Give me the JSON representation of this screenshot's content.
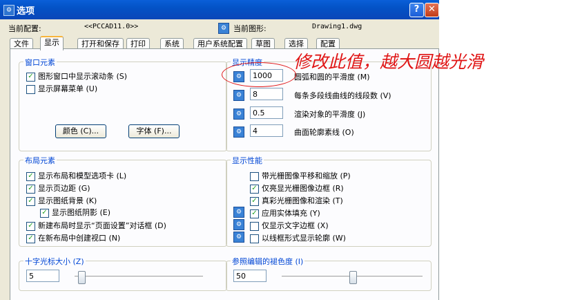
{
  "window": {
    "title": "选项",
    "help_glyph": "?",
    "close_glyph": "✕",
    "icon": "options-icon"
  },
  "info": {
    "profile_label": "当前配置:",
    "profile_value": "<<PCCAD11.0>>",
    "drawing_label": "当前图形:",
    "drawing_value": "Drawing1.dwg"
  },
  "tabs": [
    {
      "label": "文件"
    },
    {
      "label": "显示"
    },
    {
      "label": "打开和保存"
    },
    {
      "label": "打印"
    },
    {
      "label": "系统"
    },
    {
      "label": "用户系统配置"
    },
    {
      "label": "草图"
    },
    {
      "label": "选择"
    },
    {
      "label": "配置"
    }
  ],
  "active_tab": "显示",
  "window_elements": {
    "title": "窗口元素",
    "scrollbars": {
      "label": "图形窗口中显示滚动条 (S)",
      "checked": true
    },
    "screen_menu": {
      "label": "显示屏幕菜单 (U)",
      "checked": false
    },
    "colors_button": "颜色 (C)...",
    "fonts_button": "字体 (F)..."
  },
  "display_resolution": {
    "title": "显示精度",
    "arc_smoothness": {
      "value": "1000",
      "label": "圆弧和圆的平滑度 (M)"
    },
    "polyline_segments": {
      "value": "8",
      "label": "每条多段线曲线的线段数 (V)"
    },
    "render_smoothness": {
      "value": "0.5",
      "label": "渲染对象的平滑度 (J)"
    },
    "contour_lines": {
      "value": "4",
      "label": "曲面轮廓素线 (O)"
    }
  },
  "layout_elements": {
    "title": "布局元素",
    "items": [
      {
        "label": "显示布局和模型选项卡 (L)",
        "checked": true
      },
      {
        "label": "显示页边距 (G)",
        "checked": true
      },
      {
        "label": "显示图纸背景 (K)",
        "checked": true
      },
      {
        "label": "显示图纸阴影 (E)",
        "checked": true
      },
      {
        "label": "新建布局时显示“页面设置”对话框 (D)",
        "checked": true
      },
      {
        "label": "在新布局中创建视口 (N)",
        "checked": true
      }
    ]
  },
  "display_performance": {
    "title": "显示性能",
    "items": [
      {
        "label": "带光栅图像平移和缩放 (P)",
        "checked": false
      },
      {
        "label": "仅亮显光栅图像边框 (R)",
        "checked": true
      },
      {
        "label": "真彩光栅图像和渲染 (T)",
        "checked": true
      },
      {
        "label": "应用实体填充 (Y)",
        "checked": true
      },
      {
        "label": "仅显示文字边框 (X)",
        "checked": false
      },
      {
        "label": "以线框形式显示轮廓 (W)",
        "checked": false
      }
    ]
  },
  "crosshair": {
    "title": "十字光标大小 (Z)",
    "value": "5",
    "level": 0.05
  },
  "xref_fade": {
    "title": "参照编辑的褪色度 (I)",
    "value": "50",
    "level": 0.5
  },
  "annotation": {
    "text": "修改此值，越大圆越光滑",
    "color": "#e01515"
  },
  "colors": {
    "titlebar": "#0352c6",
    "group_title": "#0046d5",
    "check": "#21a121"
  }
}
